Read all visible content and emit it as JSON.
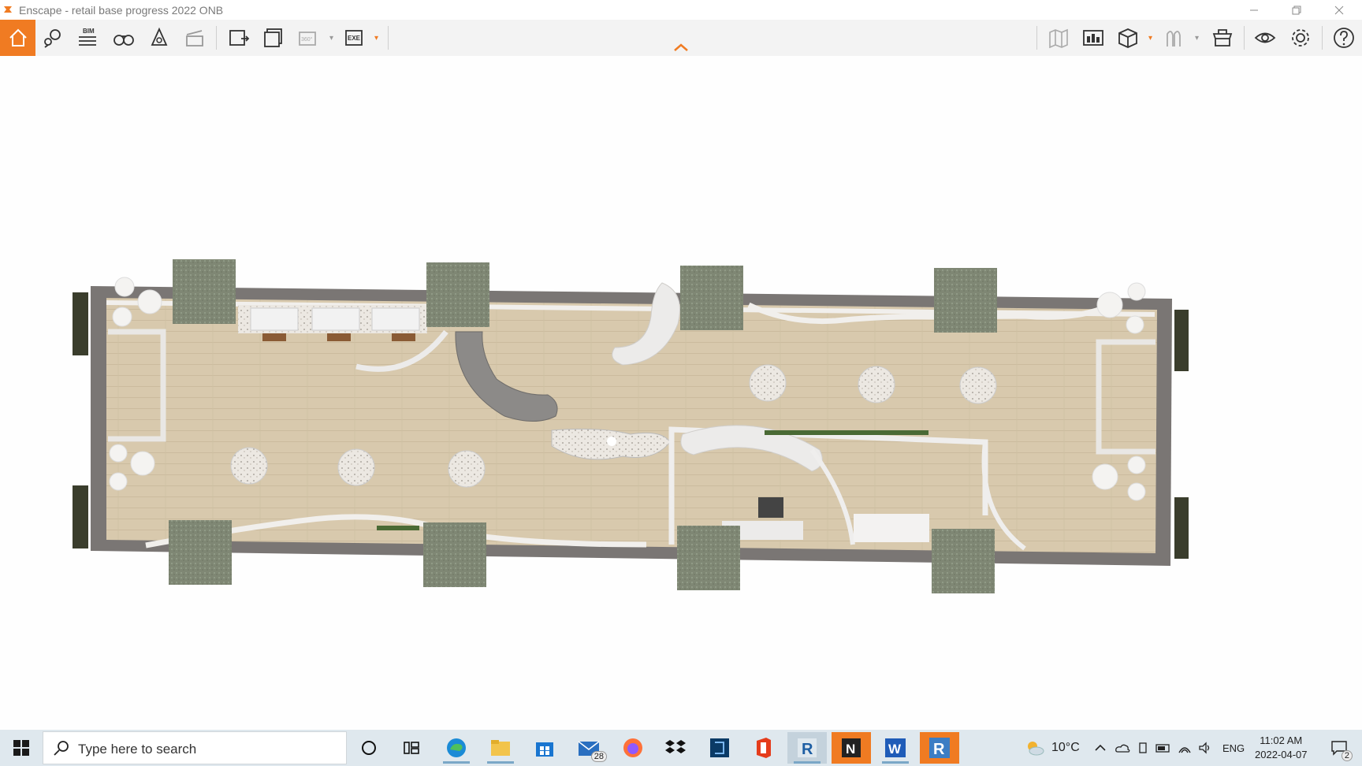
{
  "window": {
    "title": "Enscape - retail base progress 2022 ONB"
  },
  "toolbar": {
    "left_buttons": [
      "home-icon",
      "views-icon",
      "bim-icon",
      "binoculars-icon",
      "bell-icon",
      "clapper-icon",
      "export-image-icon",
      "batch-render-icon",
      "panorama-360-icon",
      "export-exe-icon"
    ],
    "bim_label": "BIM",
    "pano_label": "360°",
    "exe_label": "EXE",
    "right_buttons": [
      "map-icon",
      "site-context-icon",
      "cube-icon",
      "material-icon",
      "asset-library-icon",
      "eye-icon",
      "gear-icon",
      "help-icon"
    ],
    "accent_color": "#f07b22"
  },
  "taskbar": {
    "search_placeholder": "Type here to search",
    "mail_badge": "28",
    "weather": "10°C",
    "language": "ENG",
    "time": "11:02 AM",
    "date": "2022-04-07",
    "notifications": "2",
    "apps": [
      "cortana-icon",
      "task-view-icon",
      "edge-icon",
      "file-explorer-icon",
      "store-icon",
      "mail-icon",
      "firefox-icon",
      "dropbox-icon",
      "app-icon",
      "office-icon",
      "revit-icon",
      "notion-icon",
      "word-icon",
      "revit-active-icon"
    ]
  },
  "scene": {
    "description_free": true
  }
}
